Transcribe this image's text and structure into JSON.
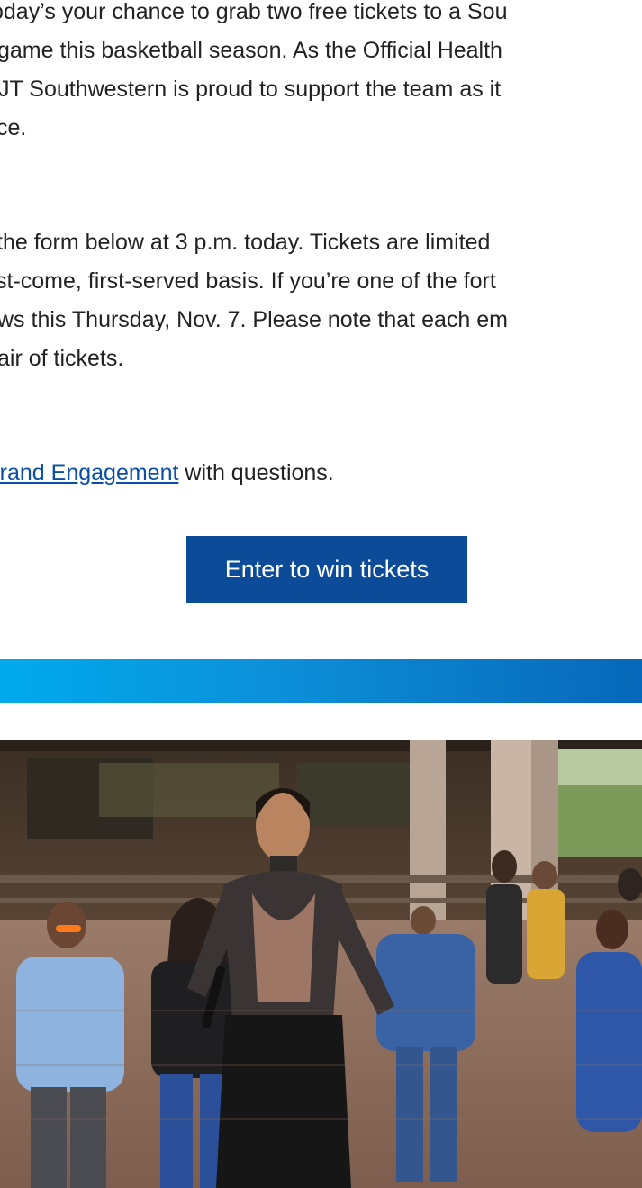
{
  "email": {
    "paragraph_1": {
      "line_1": "oday’s your chance to grab two free tickets to a Sou",
      "line_2": "game this basketball season. As the Official Health",
      "line_3": "JT Southwestern is proud to support the team as it",
      "line_4": "ce."
    },
    "paragraph_2": {
      "line_1": "the form below at 3 p.m. today. Tickets are limited",
      "line_2": "st-come, first-served basis. If you’re one of the fort",
      "line_3": "ws this Thursday, Nov. 7. Please note that each em",
      "line_4": "air of tickets."
    },
    "paragraph_3": {
      "link_text": "Brand Engagement",
      "suffix": " with questions."
    },
    "cta": {
      "label": "Enter to win tickets"
    }
  },
  "colors": {
    "button": "#0b4b97",
    "link": "#0a4fa8",
    "gradient_start": "#00aaec",
    "gradient_end": "#0668b8"
  }
}
